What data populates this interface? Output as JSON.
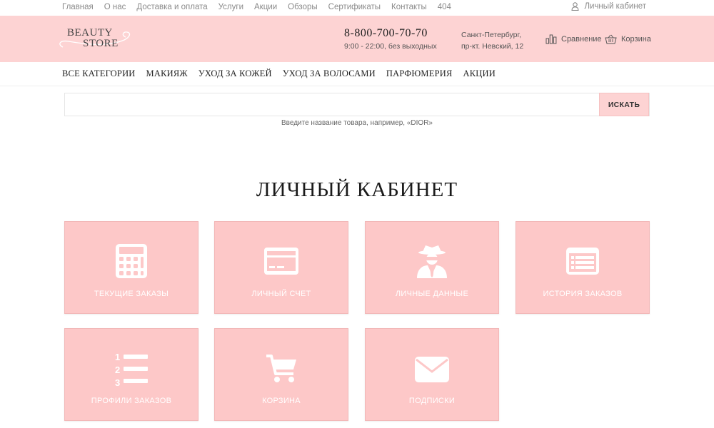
{
  "topnav": [
    "Главная",
    "О нас",
    "Доставка и оплата",
    "Услуги",
    "Акции",
    "Обзоры",
    "Сертификаты",
    "Контакты",
    "404"
  ],
  "account": {
    "label": "Личный кабинет",
    "icon": "user-icon"
  },
  "header": {
    "logo_line1": "BEAUTY",
    "logo_line2": "STORE",
    "phone": "8-800-700-70-70",
    "hours": "9:00 - 22:00, без выходных",
    "address_line1": "Санкт-Петербург,",
    "address_line2": "пр-кт. Невский, 12",
    "compare_label": "Сравнение",
    "cart_label": "Корзина"
  },
  "catnav": [
    "ВСЕ КАТЕГОРИИ",
    "МАКИЯЖ",
    "УХОД ЗА КОЖЕЙ",
    "УХОД ЗА ВОЛОСАМИ",
    "ПАРФЮМЕРИЯ",
    "АКЦИИ"
  ],
  "search": {
    "value": "",
    "button_label": "ИСКАТЬ",
    "hint": "Введите название товара, например, «DIOR»"
  },
  "page_title": "ЛИЧНЫЙ КАБИНЕТ",
  "tiles": [
    {
      "label": "ТЕКУЩИЕ ЗАКАЗЫ",
      "icon": "calculator-icon"
    },
    {
      "label": "ЛИЧНЫЙ СЧЕТ",
      "icon": "credit-card-icon"
    },
    {
      "label": "ЛИЧНЫЕ ДАННЫЕ",
      "icon": "user-secret-icon"
    },
    {
      "label": "ИСТОРИЯ ЗАКАЗОВ",
      "icon": "list-alt-icon"
    },
    {
      "label": "ПРОФИЛИ ЗАКАЗОВ",
      "icon": "numbered-list-icon"
    },
    {
      "label": "КОРЗИНА",
      "icon": "shopping-cart-icon"
    },
    {
      "label": "ПОДПИСКИ",
      "icon": "envelope-icon"
    }
  ],
  "colors": {
    "accent": "#fdd3d3",
    "tile": "#fdc8c8",
    "tile_text": "#ffffff"
  }
}
